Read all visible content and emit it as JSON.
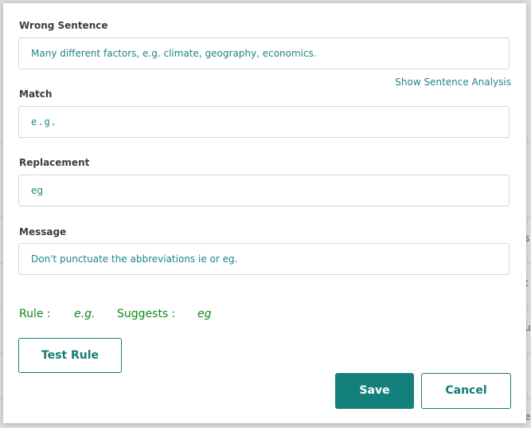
{
  "background": {
    "side_letters": [
      "s",
      "t",
      "u",
      "e"
    ]
  },
  "dialog": {
    "wrong_sentence": {
      "label": "Wrong Sentence",
      "value": "Many different factors, e.g. climate, geography, economics."
    },
    "show_analysis_link": "Show Sentence Analysis",
    "match": {
      "label": "Match",
      "value": "e.g."
    },
    "replacement": {
      "label": "Replacement",
      "value": "eg"
    },
    "message": {
      "label": "Message",
      "value": "Don't punctuate the abbreviations ie or eg."
    },
    "rule_summary": {
      "rule_label": "Rule :",
      "rule_value": "e.g.",
      "suggests_label": "Suggests :",
      "suggests_value": "eg"
    },
    "buttons": {
      "test_rule": "Test Rule",
      "save": "Save",
      "cancel": "Cancel"
    }
  },
  "colors": {
    "accent": "#14807b",
    "field_text": "#1d8582",
    "rule_text": "#0b8a1a"
  }
}
